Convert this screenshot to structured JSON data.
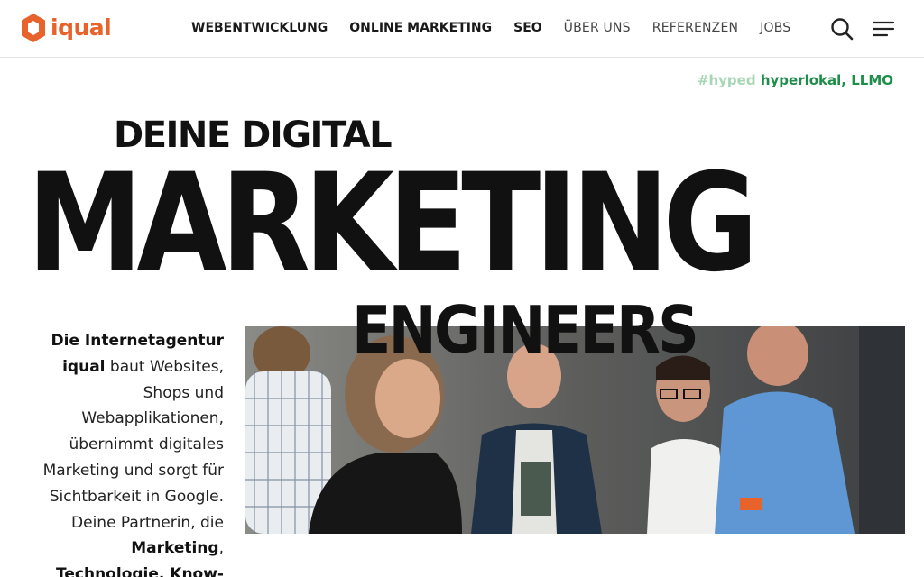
{
  "brand": {
    "name": "iqual",
    "color": "#e8632b"
  },
  "nav": {
    "items": [
      {
        "label": "WEBENTWICKLUNG",
        "weight": "bold"
      },
      {
        "label": "ONLINE MARKETING",
        "weight": "bold"
      },
      {
        "label": "SEO",
        "weight": "bold"
      },
      {
        "label": "ÜBER UNS",
        "weight": "light"
      },
      {
        "label": "REFERENZEN",
        "weight": "light"
      },
      {
        "label": "JOBS",
        "weight": "light"
      }
    ],
    "search_icon": "search-icon",
    "menu_icon": "hamburger-menu-icon"
  },
  "tagline": {
    "muted": "#hyped",
    "strong": "hyperlokal, LLMO"
  },
  "hero": {
    "line1": "DEINE DIGITAL",
    "line2": "MARKETING",
    "line3": "ENGINEERS"
  },
  "intro": {
    "b1": "Die Internetagentur",
    "b2": "iqual",
    "t1": " baut Websites, Shops und Webapplikationen, übernimmt digitales Marketing und sorgt für Sichtbarkeit in Google. Deine Partnerin, die ",
    "b3": "Marketing",
    "t2": ",",
    "b4": "Technologie, Know-"
  },
  "colors": {
    "accent_green": "#1f8e4a",
    "accent_green_light": "#a6d6b4",
    "text": "#111111"
  }
}
